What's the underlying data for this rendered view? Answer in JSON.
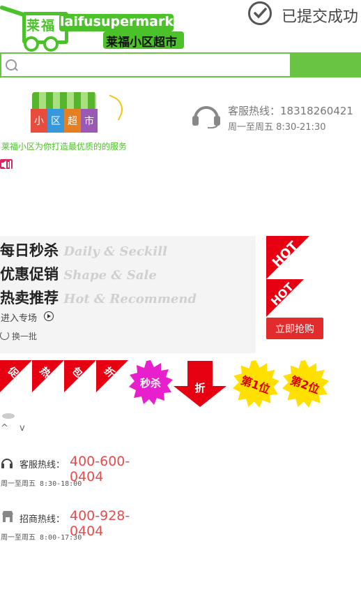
{
  "header": {
    "logo_cn": "莱福",
    "brand_en": "laifusupermarket",
    "brand_cn": "莱福小区超市",
    "status_text": "已提交成功"
  },
  "search": {
    "placeholder": "",
    "value": ""
  },
  "shop_sign": {
    "chars": [
      "小",
      "区",
      "超",
      "市"
    ]
  },
  "hotline": {
    "label_number": "客服热线：18318260421",
    "hours": "周一至周五 8:30-21:30"
  },
  "slogan": "莱福小区为你打造最优质的的服务",
  "promo": {
    "rows": [
      {
        "cn": "每日秒杀",
        "en": "Daily & Seckill"
      },
      {
        "cn": "优惠促销",
        "en": "Shape & Sale"
      },
      {
        "cn": "热卖推荐",
        "en": "Hot & Recommend"
      }
    ],
    "enter_label": "进入专场",
    "refresh_label": "换一批"
  },
  "hot_badges": [
    "HOT",
    "HOT"
  ],
  "buy_button": "立即抢购",
  "tags": [
    "促销",
    "热卖",
    "包邮",
    "折扣"
  ],
  "miaosha": "秒杀",
  "zhe": "折",
  "ranks": [
    "第1位",
    "第2位"
  ],
  "chevrons": "^ v",
  "contacts": [
    {
      "label": "客服热线：",
      "number": "400-600-0404",
      "hours": "周一至周五 8:30-18:00"
    },
    {
      "label": "招商热线：",
      "number": "400-928-0404",
      "hours": "周一至周五 8:00-17:30"
    }
  ],
  "colors": {
    "brand_green": "#4cc22a",
    "search_green": "#69c443",
    "hot_red": "#e60012",
    "buy_red": "#e22b2b",
    "number_red": "#e84c4c",
    "miaosha_magenta": "#e81fcd",
    "rank_yellow": "#ffe000"
  }
}
